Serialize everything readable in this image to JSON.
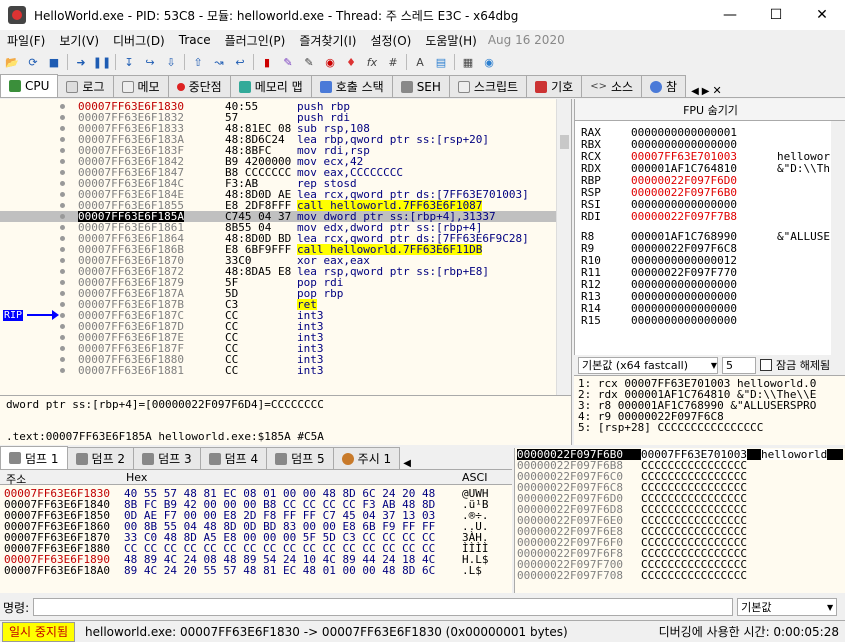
{
  "window": {
    "title": "HelloWorld.exe - PID: 53C8 - 모듈: helloworld.exe - Thread: 주 스레드 E3C - x64dbg"
  },
  "menu": [
    "파일(F)",
    "보기(V)",
    "디버그(D)",
    "Trace",
    "플러그인(P)",
    "즐겨찾기(I)",
    "설정(O)",
    "도움말(H)"
  ],
  "build_date": "Aug 16 2020",
  "tabs": [
    {
      "label": "CPU",
      "active": true
    },
    {
      "label": "로그"
    },
    {
      "label": "메모"
    },
    {
      "label": "중단점"
    },
    {
      "label": "메모리 맵"
    },
    {
      "label": "호출 스택"
    },
    {
      "label": "SEH"
    },
    {
      "label": "스크립트"
    },
    {
      "label": "기호"
    },
    {
      "label": "소스"
    },
    {
      "label": "참"
    }
  ],
  "rip_label": "RIP",
  "disasm": [
    {
      "addr": "00007FF63E6F1830",
      "bytes": "40:55",
      "ins": "push rbp"
    },
    {
      "addr": "00007FF63E6F1832",
      "bytes": "57",
      "ins": "push rdi"
    },
    {
      "addr": "00007FF63E6F1833",
      "bytes": "48:81EC 08",
      "ins": "sub rsp,108"
    },
    {
      "addr": "00007FF63E6F183A",
      "bytes": "48:8D6C24",
      "ins": "lea rbp,qword ptr ss:[rsp+20]"
    },
    {
      "addr": "00007FF63E6F183F",
      "bytes": "48:8BFC",
      "ins": "mov rdi,rsp"
    },
    {
      "addr": "00007FF63E6F1842",
      "bytes": "B9 4200000",
      "ins": "mov ecx,42"
    },
    {
      "addr": "00007FF63E6F1847",
      "bytes": "B8 CCCCCCC",
      "ins": "mov eax,CCCCCCCC"
    },
    {
      "addr": "00007FF63E6F184C",
      "bytes": "F3:AB",
      "ins": "rep stosd"
    },
    {
      "addr": "00007FF63E6F184E",
      "bytes": "48:8D0D AE",
      "ins": "lea rcx,qword ptr ds:[7FF63E701003]"
    },
    {
      "addr": "00007FF63E6F1855",
      "bytes": "E8 2DF8FFF",
      "ins": "call helloworld.7FF63E6F1087",
      "call": true
    },
    {
      "addr": "00007FF63E6F185A",
      "bytes": "C745 04 37",
      "ins": "mov dword ptr ss:[rbp+4],31337",
      "sel": true
    },
    {
      "addr": "00007FF63E6F1861",
      "bytes": "8B55 04",
      "ins": "mov edx,dword ptr ss:[rbp+4]"
    },
    {
      "addr": "00007FF63E6F1864",
      "bytes": "48:8D0D BD",
      "ins": "lea rcx,qword ptr ds:[7FF63E6F9C28]"
    },
    {
      "addr": "00007FF63E6F186B",
      "bytes": "E8 6BF9FFF",
      "ins": "call helloworld.7FF63E6F11DB",
      "call": true
    },
    {
      "addr": "00007FF63E6F1870",
      "bytes": "33C0",
      "ins": "xor eax,eax"
    },
    {
      "addr": "00007FF63E6F1872",
      "bytes": "48:8DA5 E8",
      "ins": "lea rsp,qword ptr ss:[rbp+E8]"
    },
    {
      "addr": "00007FF63E6F1879",
      "bytes": "5F",
      "ins": "pop rdi"
    },
    {
      "addr": "00007FF63E6F187A",
      "bytes": "5D",
      "ins": "pop rbp"
    },
    {
      "addr": "00007FF63E6F187B",
      "bytes": "C3",
      "ins": "ret",
      "call": true
    },
    {
      "addr": "00007FF63E6F187C",
      "bytes": "CC",
      "ins": "int3"
    },
    {
      "addr": "00007FF63E6F187D",
      "bytes": "CC",
      "ins": "int3"
    },
    {
      "addr": "00007FF63E6F187E",
      "bytes": "CC",
      "ins": "int3"
    },
    {
      "addr": "00007FF63E6F187F",
      "bytes": "CC",
      "ins": "int3"
    },
    {
      "addr": "00007FF63E6F1880",
      "bytes": "CC",
      "ins": "int3"
    },
    {
      "addr": "00007FF63E6F1881",
      "bytes": "CC",
      "ins": "int3"
    }
  ],
  "info_line1": "dword ptr ss:[rbp+4]=[00000022F097F6D4]=CCCCCCCC",
  "info_line2": ".text:00007FF63E6F185A helloworld.exe:$185A #C5A",
  "fpu_header": "FPU 숨기기",
  "registers": [
    {
      "name": "RAX",
      "value": "0000000000000001",
      "comment": ""
    },
    {
      "name": "RBX",
      "value": "0000000000000000",
      "comment": ""
    },
    {
      "name": "RCX",
      "value": "00007FF63E701003",
      "comment": "hellowor",
      "changed": true
    },
    {
      "name": "RDX",
      "value": "000001AF1C764810",
      "comment": "&\"D:\\\\Th"
    },
    {
      "name": "RBP",
      "value": "00000022F097F6D0",
      "comment": "",
      "changed": true
    },
    {
      "name": "RSP",
      "value": "00000022F097F6B0",
      "comment": "",
      "changed": true
    },
    {
      "name": "RSI",
      "value": "0000000000000000",
      "comment": ""
    },
    {
      "name": "RDI",
      "value": "00000022F097F7B8",
      "comment": "",
      "changed": true
    },
    {
      "name": "R8",
      "value": "000001AF1C768990",
      "comment": "&\"ALLUSEI"
    },
    {
      "name": "R9",
      "value": "00000022F097F6C8",
      "comment": ""
    },
    {
      "name": "R10",
      "value": "0000000000000012",
      "comment": ""
    },
    {
      "name": "R11",
      "value": "00000022F097F770",
      "comment": ""
    },
    {
      "name": "R12",
      "value": "0000000000000000",
      "comment": ""
    },
    {
      "name": "R13",
      "value": "0000000000000000",
      "comment": ""
    },
    {
      "name": "R14",
      "value": "0000000000000000",
      "comment": ""
    },
    {
      "name": "R15",
      "value": "0000000000000000",
      "comment": ""
    }
  ],
  "callconv": {
    "selected": "기본값 (x64 fastcall)",
    "count": "5",
    "lock_label": "잠금 해제됨"
  },
  "args": [
    "1: rcx 00007FF63E701003 helloworld.0",
    "2: rdx 000001AF1C764810 &\"D:\\\\The\\\\E",
    "3: r8 000001AF1C768990 &\"ALLUSERSPRO",
    "4: r9 00000022F097F6C8",
    "5: [rsp+28] CCCCCCCCCCCCCCCC"
  ],
  "bottom_tabs": [
    "덤프 1",
    "덤프 2",
    "덤프 3",
    "덤프 4",
    "덤프 5",
    "주시 1"
  ],
  "dump_headers": {
    "addr": "주소",
    "hex": "Hex",
    "ascii": "ASCI"
  },
  "dump": [
    {
      "addr": "00007FF63E6F1830",
      "hex": "40 55 57 48 81 EC 08 01 00 00 48 8D 6C 24 20 48",
      "ascii": "@UWH"
    },
    {
      "addr": "00007FF63E6F1840",
      "hex": "8B FC B9 42 00 00 00 B8 CC CC CC CC F3 AB 48 8D",
      "ascii": ".ü¹B"
    },
    {
      "addr": "00007FF63E6F1850",
      "hex": "0D AE F7 00 00 E8 2D F8 FF FF C7 45 04 37 13 03",
      "ascii": ".®÷."
    },
    {
      "addr": "00007FF63E6F1860",
      "hex": "00 8B 55 04 48 8D 0D BD 83 00 00 E8 6B F9 FF FF",
      "ascii": "..U."
    },
    {
      "addr": "00007FF63E6F1870",
      "hex": "33 C0 48 8D A5 E8 00 00 00 5F 5D C3 CC CC CC CC",
      "ascii": "3ÀH."
    },
    {
      "addr": "00007FF63E6F1880",
      "hex": "CC CC CC CC CC CC CC CC CC CC CC CC CC CC CC CC",
      "ascii": "ÌÌÌÌ"
    },
    {
      "addr": "00007FF63E6F1890",
      "hex": "48 89 4C 24 08 48 89 54 24 10 4C 89 44 24 18 4C",
      "ascii": "H.L$"
    },
    {
      "addr": "00007FF63E6F18A0",
      "hex": "89 4C 24 20 55 57 48 81 EC 48 01 00 00 48 8D 6C",
      "ascii": ".L$ "
    }
  ],
  "stack": [
    {
      "addr": "00000022F097F6B0",
      "val": "00007FF63E701003",
      "cmt": "helloworld",
      "top": true
    },
    {
      "addr": "00000022F097F6B8",
      "val": "CCCCCCCCCCCCCCCC",
      "cmt": ""
    },
    {
      "addr": "00000022F097F6C0",
      "val": "CCCCCCCCCCCCCCCC",
      "cmt": ""
    },
    {
      "addr": "00000022F097F6C8",
      "val": "CCCCCCCCCCCCCCCC",
      "cmt": ""
    },
    {
      "addr": "00000022F097F6D0",
      "val": "CCCCCCCCCCCCCCCC",
      "cmt": ""
    },
    {
      "addr": "00000022F097F6D8",
      "val": "CCCCCCCCCCCCCCCC",
      "cmt": ""
    },
    {
      "addr": "00000022F097F6E0",
      "val": "CCCCCCCCCCCCCCCC",
      "cmt": ""
    },
    {
      "addr": "00000022F097F6E8",
      "val": "CCCCCCCCCCCCCCCC",
      "cmt": ""
    },
    {
      "addr": "00000022F097F6F0",
      "val": "CCCCCCCCCCCCCCCC",
      "cmt": ""
    },
    {
      "addr": "00000022F097F6F8",
      "val": "CCCCCCCCCCCCCCCC",
      "cmt": ""
    },
    {
      "addr": "00000022F097F700",
      "val": "CCCCCCCCCCCCCCCC",
      "cmt": ""
    },
    {
      "addr": "00000022F097F708",
      "val": "CCCCCCCCCCCCCCCC",
      "cmt": ""
    }
  ],
  "command": {
    "label": "명령:",
    "default": "기본값"
  },
  "status": {
    "paused": "일시 중지됨",
    "message": "helloworld.exe: 00007FF63E6F1830 -> 00007FF63E6F1830 (0x00000001 bytes)",
    "time": "디버깅에 사용한 시간: 0:00:05:28"
  }
}
